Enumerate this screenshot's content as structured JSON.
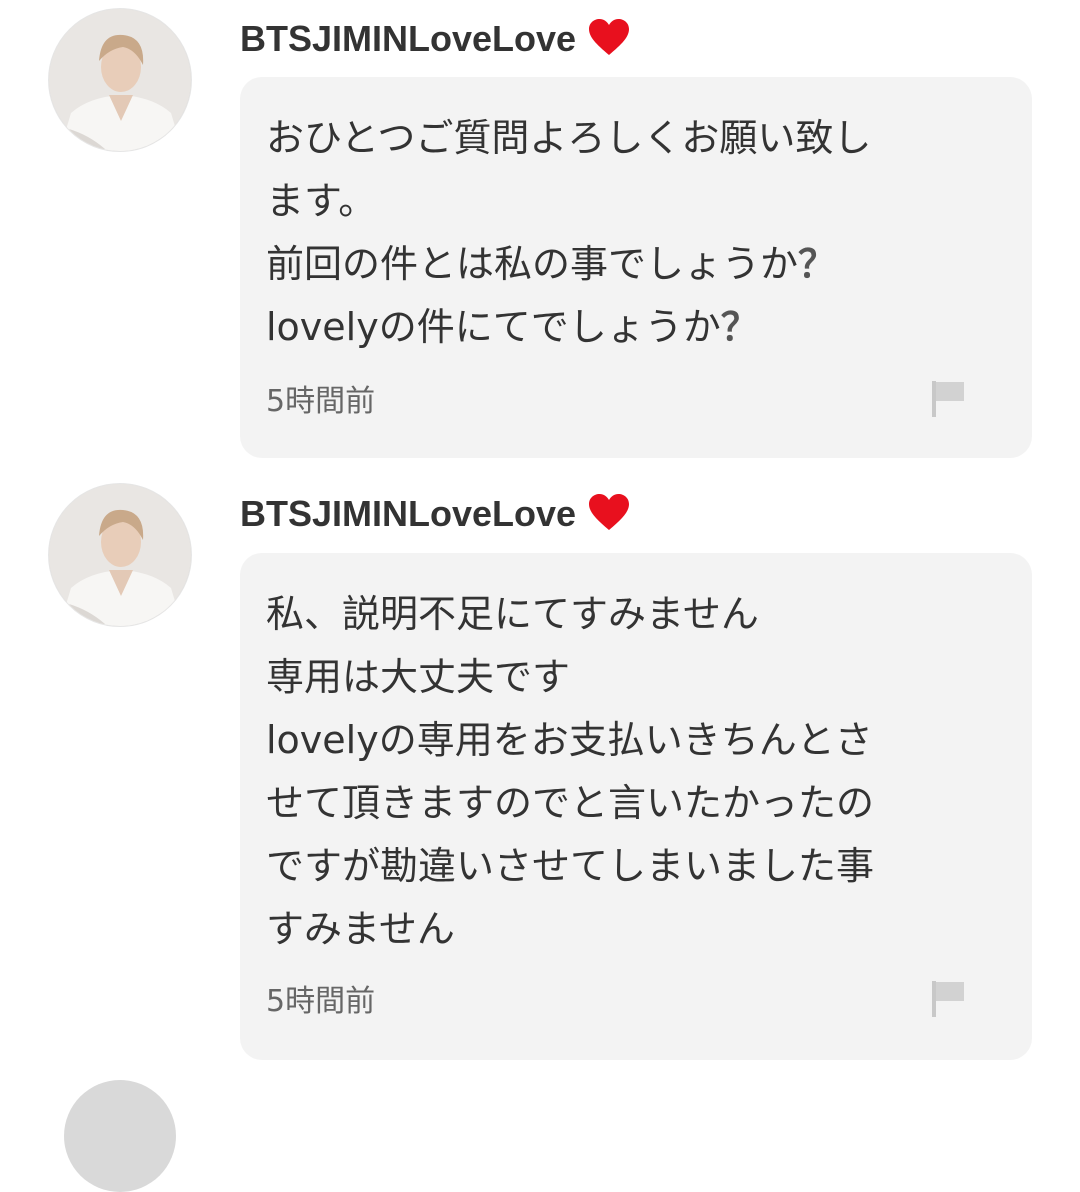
{
  "comments": [
    {
      "username": "BTSJIMINLoveLove",
      "heart_icon": "heart-icon",
      "lines": [
        "おひとつご質問よろしくお願い致し",
        "ます。",
        "前回の件とは私の事でしょうか",
        "lovelyの件にてでしょうか"
      ],
      "question_marks": [
        "？",
        "？"
      ],
      "time": "5時間前",
      "flag_icon": "flag-icon"
    },
    {
      "username": "BTSJIMINLoveLove",
      "heart_icon": "heart-icon",
      "lines": [
        "私、説明不足にてすみません",
        "専用は大丈夫です",
        "lovelyの専用をお支払いきちんとさ",
        "せて頂きますのでと言いたかったの",
        "ですが勘違いさせてしまいました事",
        "すみません"
      ],
      "time": "5時間前",
      "flag_icon": "flag-icon"
    }
  ],
  "colors": {
    "heart": "#e8101e",
    "bubble": "#f3f3f3",
    "text": "#333333",
    "time": "#666666",
    "flag": "#c8c8c8"
  }
}
